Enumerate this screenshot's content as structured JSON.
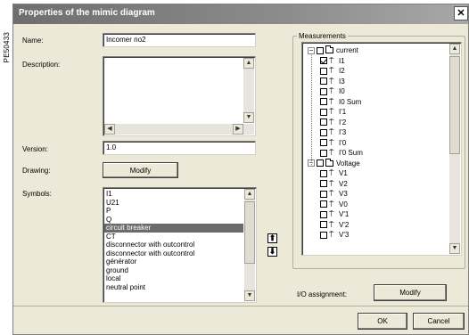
{
  "side_code": "PE50433",
  "window": {
    "title": "Properties of the mimic diagram"
  },
  "form": {
    "name_label": "Name:",
    "name_value": "Incomer no2",
    "description_label": "Description:",
    "description_value": "",
    "version_label": "Version:",
    "version_value": "1.0",
    "drawing_label": "Drawing:",
    "drawing_button": "Modify",
    "symbols_label": "Symbols:"
  },
  "symbols": {
    "items": [
      "I1",
      "U21",
      "P",
      "Q",
      "circuit breaker",
      "CT",
      "disconnector with outcontrol",
      "disconnector with outcontrol",
      "générator",
      "ground",
      "local",
      "neutral point"
    ],
    "selected_index": 4
  },
  "measurements": {
    "group_label": "Measurements",
    "current_label": "current",
    "current_items": [
      "I1",
      "I2",
      "I3",
      "I0",
      "I0 Sum",
      "I'1",
      "I'2",
      "I'3",
      "I'0",
      "I'0 Sum"
    ],
    "current_checked": [
      true,
      false,
      false,
      false,
      false,
      false,
      false,
      false,
      false,
      false
    ],
    "voltage_label": "Voltage",
    "voltage_items": [
      "V1",
      "V2",
      "V3",
      "V0",
      "V'1",
      "V'2",
      "V'3"
    ],
    "expander_symbol": "−"
  },
  "io": {
    "label": "I/O assignment:",
    "button": "Modify"
  },
  "footer": {
    "ok": "OK",
    "cancel": "Cancel"
  },
  "glyphs": {
    "close": "✕",
    "up": "⬆",
    "down": "⬇",
    "scroll_up": "▲",
    "scroll_down": "▼",
    "scroll_left": "◀",
    "scroll_right": "▶"
  }
}
